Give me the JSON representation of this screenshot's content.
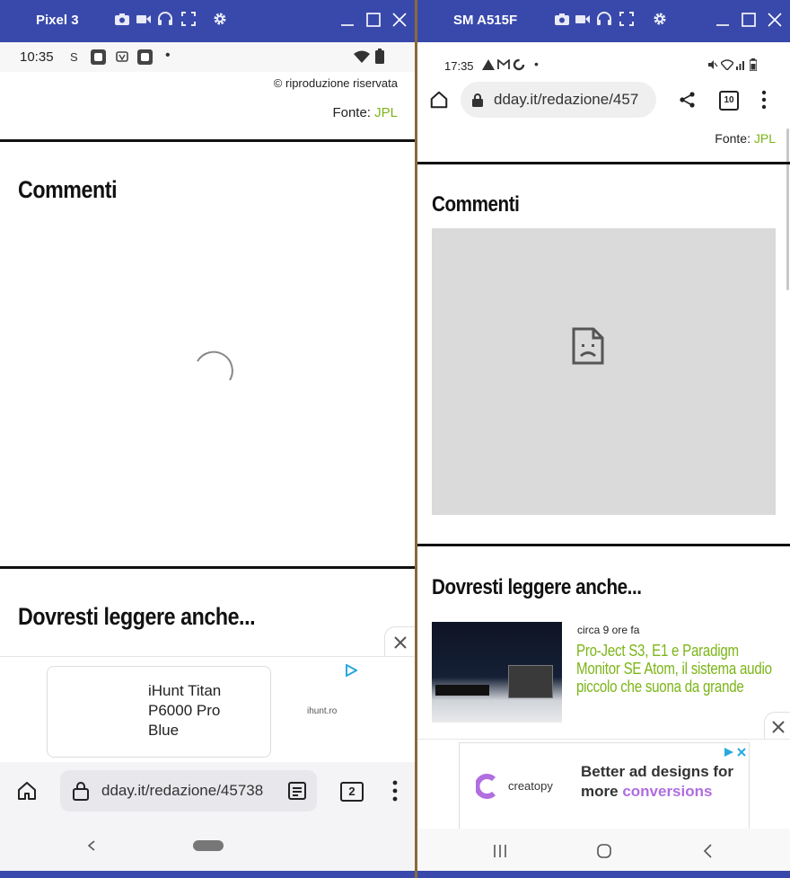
{
  "left_window": {
    "title": "Pixel 3",
    "status": {
      "time": "10:35",
      "dot": "•"
    },
    "page": {
      "copyright": "© riproduzione riservata",
      "source_label": "Fonte:",
      "source_link": "JPL",
      "comments_heading": "Commenti",
      "read_also_heading": "Dovresti leggere anche..."
    },
    "ad": {
      "product_title": "iHunt Titan P6000 Pro Blue",
      "domain": "ihunt.ro"
    },
    "browser": {
      "url": "dday.it/redazione/45738",
      "tab_count": "2"
    }
  },
  "right_window": {
    "title": "SM A515F",
    "status": {
      "time": "17:35",
      "dot": "•"
    },
    "browser": {
      "url": "dday.it/redazione/457",
      "tab_count": "10"
    },
    "page": {
      "source_label": "Fonte:",
      "source_link": "JPL",
      "comments_heading": "Commenti",
      "read_also_heading": "Dovresti leggere anche...",
      "article": {
        "time_ago": "circa 9 ore fa",
        "title": "Pro-Ject S3, E1 e Paradigm Monitor SE Atom, il sistema audio piccolo che suona da grande"
      }
    },
    "ad": {
      "brand": "creatopy",
      "headline": "Better ad designs for more",
      "highlight": "conversions"
    }
  },
  "colors": {
    "titlebar": "#3949ab",
    "link_green": "#7cb518",
    "ad_purple": "#b06ee0"
  }
}
